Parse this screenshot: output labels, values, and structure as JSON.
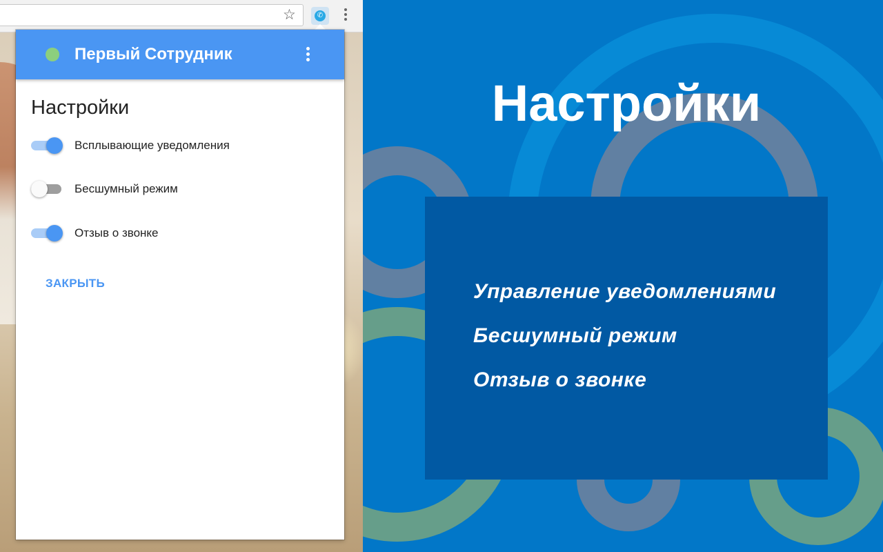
{
  "browser": {
    "toolbar": {
      "bookmark_icon": "star-icon",
      "extension_icon": "phone-extension-icon",
      "menu_icon": "kebab-menu-icon"
    }
  },
  "popup": {
    "header": {
      "title": "Первый Сотрудник",
      "status_color": "#8ccf7e",
      "background_color": "#4a96f3"
    },
    "settings_heading": "Настройки",
    "settings": [
      {
        "label": "Всплывающие уведомления",
        "enabled": true
      },
      {
        "label": "Бесшумный режим",
        "enabled": false
      },
      {
        "label": "Отзыв о звонке",
        "enabled": true
      }
    ],
    "close_label": "ЗАКРЫТЬ"
  },
  "promo": {
    "title": "Настройки",
    "items": [
      "Управление уведомлениями",
      "Бесшумный режим",
      "Отзыв о звонке"
    ],
    "background_color": "#0277c8",
    "box_color": "#0159a3"
  }
}
